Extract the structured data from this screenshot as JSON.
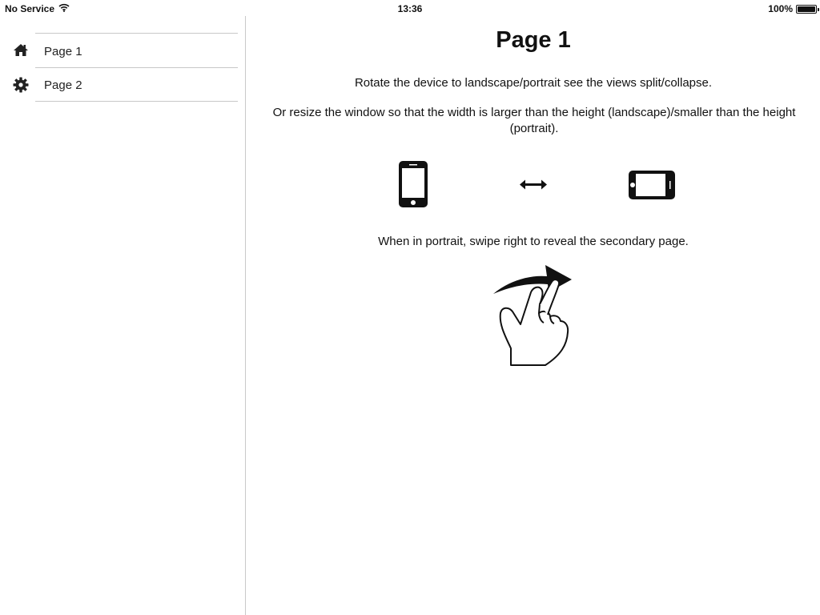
{
  "status_bar": {
    "carrier": "No Service",
    "time": "13:36",
    "battery": "100%",
    "battery_level": 1.0
  },
  "sidebar": {
    "items": [
      {
        "label": "Page 1",
        "icon": "home-icon"
      },
      {
        "label": "Page 2",
        "icon": "gear-icon"
      }
    ]
  },
  "main": {
    "title": "Page 1",
    "instruction_rotate": "Rotate the device to landscape/portrait see the views split/collapse.",
    "instruction_resize": "Or resize the window so that the width is larger than the height (landscape)/smaller than the height (portrait).",
    "instruction_swipe": "When in portrait, swipe right to reveal the secondary page.",
    "icons": [
      "phone-portrait-icon",
      "double-arrow-icon",
      "phone-landscape-icon",
      "swipe-right-hand-icon"
    ]
  }
}
